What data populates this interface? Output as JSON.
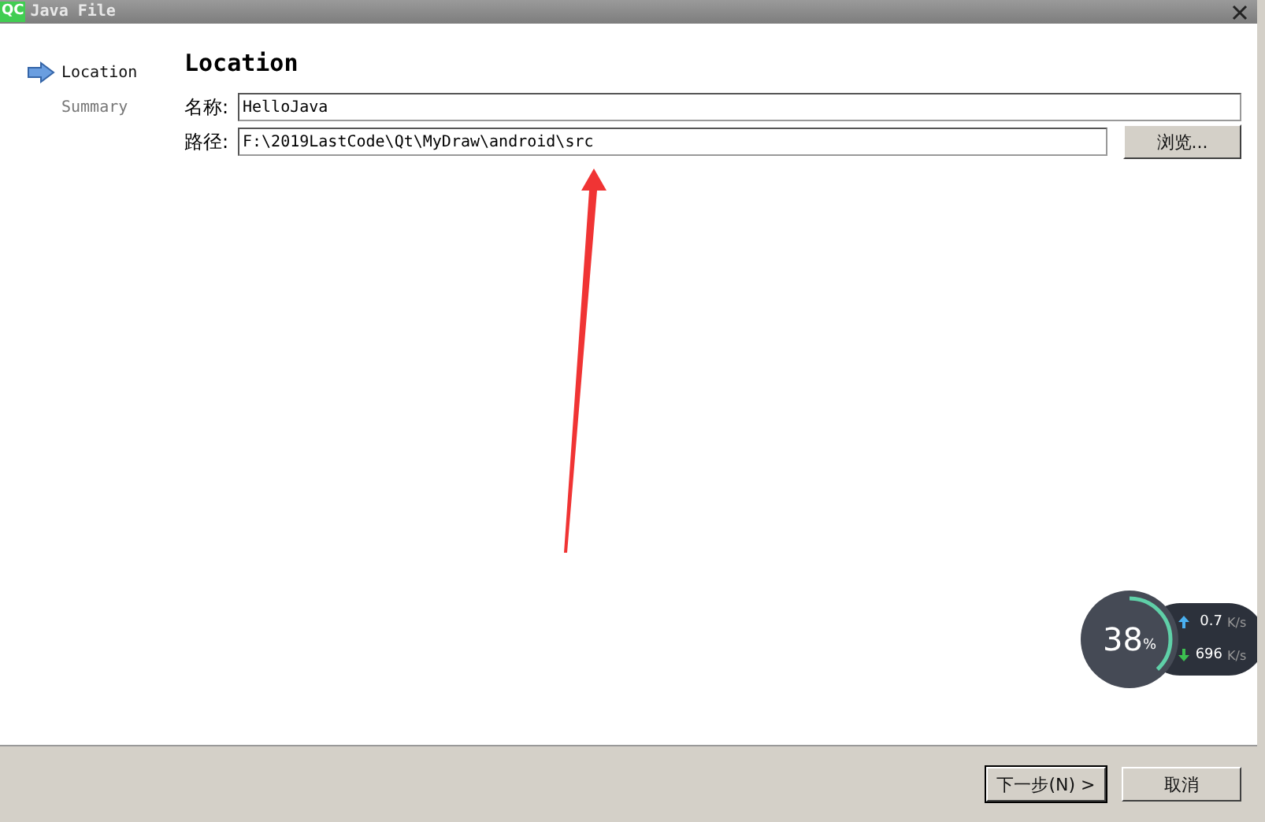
{
  "window": {
    "title": "Java File",
    "logo": "QC"
  },
  "steps": [
    {
      "label": "Location",
      "selected": true
    },
    {
      "label": "Summary",
      "selected": false
    }
  ],
  "page_title": "Location",
  "fields": [
    {
      "label": "名称:",
      "value": "HelloJava"
    },
    {
      "label": "路径:",
      "value": "F:\\2019LastCode\\Qt\\MyDraw\\android\\src",
      "button": "浏览..."
    }
  ],
  "net_monitor": {
    "percent": "38",
    "unit": "%",
    "level": 0.38,
    "upload": "0.7",
    "upload_unit": "K/s",
    "download": "696",
    "download_unit": "K/s"
  },
  "buttons": [
    {
      "label": "下一步(N) >",
      "focused": true
    },
    {
      "label": "取消",
      "focused": false
    }
  ]
}
